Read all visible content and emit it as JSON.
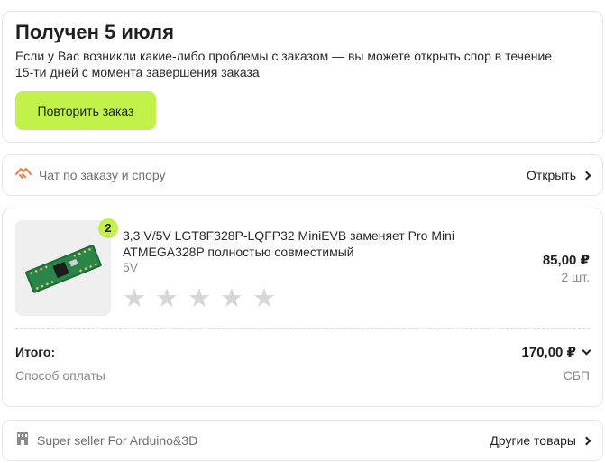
{
  "status": {
    "title": "Получен 5 июля",
    "description": "Если у Вас возникли какие-либо проблемы с заказом — вы можете открыть спор в течение 15-ти дней с момента завершения заказа",
    "repeat_button": "Повторить заказ"
  },
  "chat": {
    "icon": "handshake-icon",
    "label": "Чат по заказу и спору",
    "action": "Открыть"
  },
  "product": {
    "quantity_badge": "2",
    "name": "3,3 V/5V LGT8F328P-LQFP32 MiniEVB заменяет Pro Mini ATMEGA328P полностью совместимый",
    "variant": "5V",
    "price": "85,00 ₽",
    "count": "2 шт.",
    "rating_stars": 5,
    "rating_filled": 0
  },
  "summary": {
    "total_label": "Итого:",
    "total_value": "170,00 ₽",
    "payment_label": "Способ оплаты",
    "payment_value": "СБП"
  },
  "seller": {
    "icon": "store-icon",
    "name": "Super seller For Arduino&3D",
    "action": "Другие товары"
  },
  "colors": {
    "accent": "#c2f24a",
    "chat_icon": "#f07a3a",
    "muted_text": "#8a8a8a"
  }
}
